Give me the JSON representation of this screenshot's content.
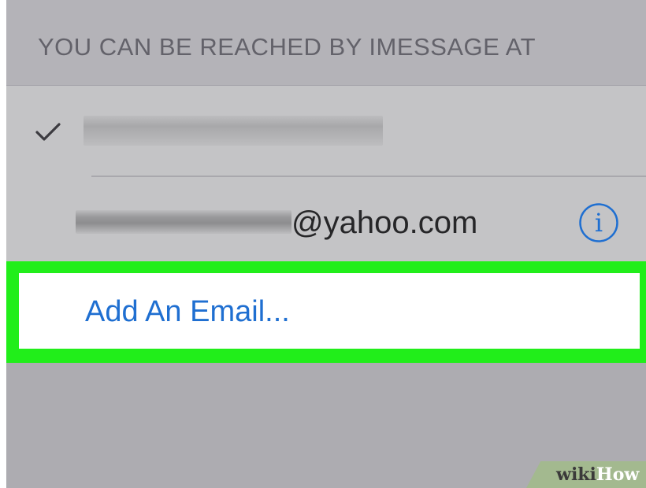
{
  "section_header": {
    "text": "YOU CAN BE REACHED BY IMESSAGE AT"
  },
  "addresses": {
    "phone": {
      "checked": true,
      "check_icon": "checkmark-icon",
      "value_redacted": true
    },
    "email": {
      "domain_suffix": "@yahoo.com",
      "local_part_redacted": true,
      "info_icon": "info-circle-icon"
    }
  },
  "add_email": {
    "label": "Add An Email..."
  },
  "watermark": {
    "wiki": "wiki",
    "how": "How"
  },
  "colors": {
    "link_blue": "#1f6fd1",
    "highlight_green": "#21ee1a",
    "header_text": "#63626a"
  }
}
